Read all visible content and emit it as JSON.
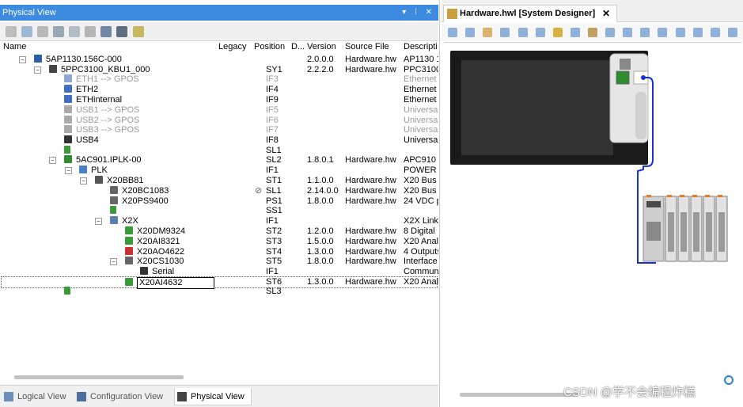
{
  "left_panel": {
    "title": "Physical View",
    "title_controls": "▾ ⁞ ✕",
    "columns": {
      "name": "Name",
      "legacy": "Legacy",
      "position": "Position",
      "d": "D...",
      "version": "Version",
      "source": "Source File",
      "description": "Descripti"
    },
    "rows": [
      {
        "name": "5AP1130.156C-000",
        "pos": "",
        "ver": "2.0.0.0",
        "src": "Hardware.hw",
        "desc": "AP1130 1"
      },
      {
        "name": "5PPC3100_KBU1_000",
        "pos": "SY1",
        "ver": "2.2.2.0",
        "src": "Hardware.hw",
        "desc": "PPC3100"
      },
      {
        "name": "ETH1 --> GPOS",
        "pos": "IF3",
        "ver": "",
        "src": "",
        "desc": "Ethernet"
      },
      {
        "name": "ETH2",
        "pos": "IF4",
        "ver": "",
        "src": "",
        "desc": "Ethernet"
      },
      {
        "name": "ETHinternal",
        "pos": "IF9",
        "ver": "",
        "src": "",
        "desc": "Ethernet"
      },
      {
        "name": "USB1 --> GPOS",
        "pos": "IF5",
        "ver": "",
        "src": "",
        "desc": "Universa"
      },
      {
        "name": "USB2 --> GPOS",
        "pos": "IF6",
        "ver": "",
        "src": "",
        "desc": "Universa"
      },
      {
        "name": "USB3 --> GPOS",
        "pos": "IF7",
        "ver": "",
        "src": "",
        "desc": "Universa"
      },
      {
        "name": "USB4",
        "pos": "IF8",
        "ver": "",
        "src": "",
        "desc": "Universa"
      },
      {
        "name": "",
        "pos": "SL1",
        "ver": "",
        "src": "",
        "desc": ""
      },
      {
        "name": "5AC901.IPLK-00",
        "pos": "SL2",
        "ver": "1.8.0.1",
        "src": "Hardware.hw",
        "desc": "APC910"
      },
      {
        "name": "PLK",
        "pos": "IF1",
        "ver": "",
        "src": "",
        "desc": "POWER"
      },
      {
        "name": "X20BB81",
        "pos": "ST1",
        "ver": "1.1.0.0",
        "src": "Hardware.hw",
        "desc": "X20 Bus"
      },
      {
        "name": "X20BC1083",
        "pos": "SL1",
        "ver": "2.14.0.0",
        "src": "Hardware.hw",
        "desc": "X20 Bus"
      },
      {
        "name": "X20PS9400",
        "pos": "PS1",
        "ver": "1.8.0.0",
        "src": "Hardware.hw",
        "desc": "24 VDC p"
      },
      {
        "name": "",
        "pos": "SS1",
        "ver": "",
        "src": "",
        "desc": ""
      },
      {
        "name": "X2X",
        "pos": "IF1",
        "ver": "",
        "src": "",
        "desc": "X2X Link"
      },
      {
        "name": "X20DM9324",
        "pos": "ST2",
        "ver": "1.2.0.0",
        "src": "Hardware.hw",
        "desc": "8 Digital"
      },
      {
        "name": "X20AI8321",
        "pos": "ST3",
        "ver": "1.5.0.0",
        "src": "Hardware.hw",
        "desc": "X20 Anal"
      },
      {
        "name": "X20AO4622",
        "pos": "ST4",
        "ver": "1.3.0.0",
        "src": "Hardware.hw",
        "desc": "4 Outputs"
      },
      {
        "name": "X20CS1030",
        "pos": "ST5",
        "ver": "1.8.0.0",
        "src": "Hardware.hw",
        "desc": "Interface"
      },
      {
        "name": "Serial",
        "pos": "IF1",
        "ver": "",
        "src": "",
        "desc": "Commun"
      },
      {
        "name": "X20AI4632",
        "pos": "ST6",
        "ver": "1.3.0.0",
        "src": "Hardware.hw",
        "desc": "X20 Anal"
      },
      {
        "name": "",
        "pos": "SL3",
        "ver": "",
        "src": "",
        "desc": ""
      }
    ],
    "tabs": [
      "Logical View",
      "Configuration View",
      "Physical View"
    ]
  },
  "right_panel": {
    "tab_title": "Hardware.hwl [System Designer]",
    "tab_close": "✕"
  },
  "watermark": "CSDN @学不会编程炸糕",
  "colors": {
    "title_bar": "#3c8be0",
    "cable": "#1730d8",
    "disabled_text": "#9a9a9a"
  }
}
